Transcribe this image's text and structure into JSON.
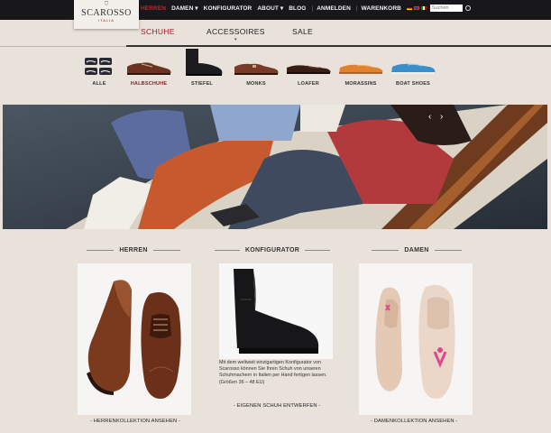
{
  "logo": {
    "name": "SCAROSSO",
    "subtitle": "ITALIA",
    "crest": "⛉"
  },
  "topnav": {
    "items": [
      {
        "label": "HERREN",
        "active": true
      },
      {
        "label": "DAMEN ▾",
        "active": false
      },
      {
        "label": "KONFIGURATOR",
        "active": false
      },
      {
        "label": "ABOUT ▾",
        "active": false
      },
      {
        "label": "BLOG",
        "active": false
      }
    ],
    "anmelden": "ANMELDEN",
    "warenkorb": "WARENKORB",
    "search_placeholder": "Suchen",
    "search_icon": "search-icon"
  },
  "mainnav": {
    "schuhe": "SCHUHE",
    "accessoires": "ACCESSOIRES",
    "accessoires_chevron": "▾",
    "sale": "SALE"
  },
  "categories": [
    {
      "label": "ALLE",
      "active": false
    },
    {
      "label": "HALBSCHUHE",
      "active": true
    },
    {
      "label": "STIEFEL",
      "active": false
    },
    {
      "label": "MONKS",
      "active": false
    },
    {
      "label": "LOAFER",
      "active": false
    },
    {
      "label": "MORASSINS",
      "active": false
    },
    {
      "label": "BOAT SHOES",
      "active": false
    }
  ],
  "hero": {
    "prev_arrow": "‹",
    "next_arrow": "›"
  },
  "sections": {
    "herren": {
      "title": "HERREN",
      "link": "- HERRENKOLLEKTION ANSEHEN -"
    },
    "konfigurator": {
      "title": "KONFIGURATOR",
      "text": "Mit dem weltweit einzigartigen Konfigurator von Scarosso können Sie Ihren Schuh von unseren Schuhmachern in Italien per Hand fertigen lassen.",
      "sizes": "(Größen 36 – 48 EU)",
      "link": "- EIGENEN SCHUH ENTWERFEN -"
    },
    "damen": {
      "title": "DAMEN",
      "link": "- DAMENKOLLEKTION ANSEHEN -"
    }
  },
  "colors": {
    "topbar": "#18181c",
    "accent_red": "#9b2028",
    "background": "#e9e2da"
  }
}
